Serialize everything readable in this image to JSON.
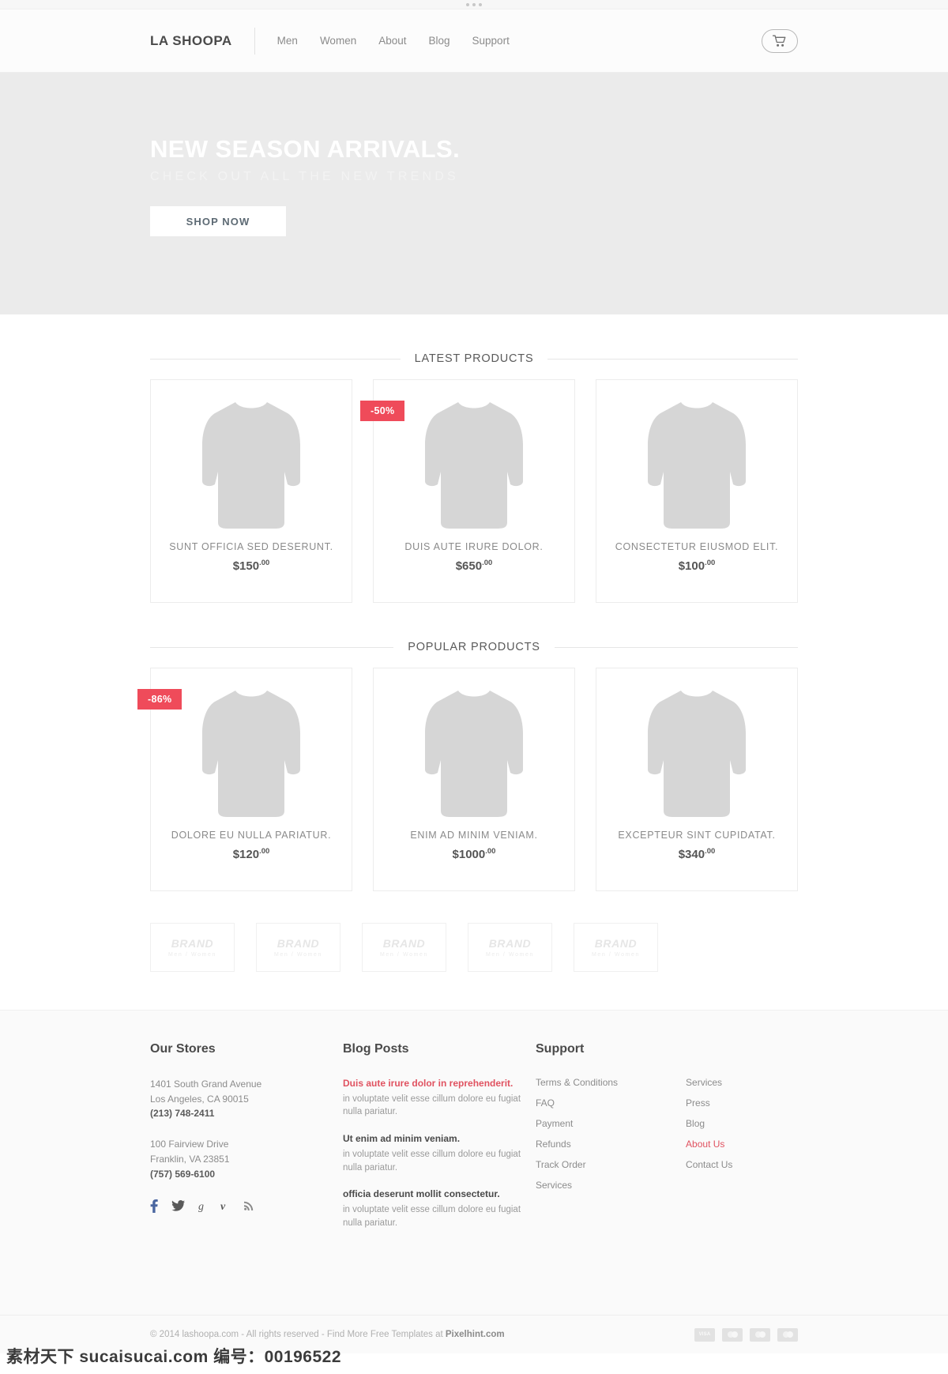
{
  "header": {
    "logo": "LA SHOOPA",
    "nav": [
      {
        "label": "Men"
      },
      {
        "label": "Women"
      },
      {
        "label": "About"
      },
      {
        "label": "Blog"
      },
      {
        "label": "Support"
      }
    ],
    "cart_icon": "shopping-cart-icon"
  },
  "hero": {
    "title": "NEW SEASON ARRIVALS.",
    "subtitle": "CHECK OUT ALL THE NEW TRENDS",
    "cta": "SHOP NOW",
    "background_color": "#ebebeb"
  },
  "sections": [
    {
      "heading": "LATEST PRODUCTS",
      "products": [
        {
          "title": "SUNT OFFICIA SED DESERUNT.",
          "price": "$150",
          "cents": ".00",
          "badge": null
        },
        {
          "title": "DUIS AUTE IRURE DOLOR.",
          "price": "$650",
          "cents": ".00",
          "badge": "-50%"
        },
        {
          "title": "CONSECTETUR EIUSMOD ELIT.",
          "price": "$100",
          "cents": ".00",
          "badge": null
        }
      ]
    },
    {
      "heading": "POPULAR PRODUCTS",
      "products": [
        {
          "title": "DOLORE EU NULLA PARIATUR.",
          "price": "$120",
          "cents": ".00",
          "badge": "-86%"
        },
        {
          "title": "ENIM AD MINIM VENIAM.",
          "price": "$1000",
          "cents": ".00",
          "badge": null
        },
        {
          "title": "EXCEPTEUR SINT CUPIDATAT.",
          "price": "$340",
          "cents": ".00",
          "badge": null
        }
      ]
    }
  ],
  "brands": [
    {
      "name": "BRAND",
      "tagline": "Men / Women"
    },
    {
      "name": "BRAND",
      "tagline": "Men / Women"
    },
    {
      "name": "BRAND",
      "tagline": "Men / Women"
    },
    {
      "name": "BRAND",
      "tagline": "Men / Women"
    },
    {
      "name": "BRAND",
      "tagline": "Men / Women"
    }
  ],
  "footer": {
    "stores": {
      "heading": "Our Stores",
      "locations": [
        {
          "address": "1401 South Grand Avenue",
          "city": "Los Angeles, CA 90015",
          "phone": "(213) 748-2411"
        },
        {
          "address": "100 Fairview Drive",
          "city": "Franklin, VA 23851",
          "phone": "(757) 569-6100"
        }
      ],
      "social": [
        {
          "name": "facebook-icon",
          "glyph": "f"
        },
        {
          "name": "twitter-icon",
          "glyph": "t"
        },
        {
          "name": "google-icon",
          "glyph": "g"
        },
        {
          "name": "vimeo-icon",
          "glyph": "v"
        },
        {
          "name": "rss-icon",
          "glyph": "r"
        }
      ]
    },
    "blog": {
      "heading": "Blog Posts",
      "posts": [
        {
          "title": "Duis aute irure dolor in reprehenderit.",
          "excerpt": " in voluptate velit esse cillum dolore eu fugiat nulla pariatur.",
          "active": true
        },
        {
          "title": "Ut enim ad minim veniam.",
          "excerpt": " in voluptate velit esse cillum dolore eu fugiat nulla pariatur.",
          "active": false
        },
        {
          "title": "officia deserunt mollit consectetur.",
          "excerpt": " in voluptate velit esse cillum dolore eu fugiat nulla pariatur.",
          "active": false
        }
      ]
    },
    "support": {
      "heading": "Support",
      "column_one": [
        {
          "label": "Terms & Conditions",
          "active": false
        },
        {
          "label": "FAQ",
          "active": false
        },
        {
          "label": "Payment",
          "active": false
        },
        {
          "label": "Refunds",
          "active": false
        },
        {
          "label": "Track Order",
          "active": false
        },
        {
          "label": "Services",
          "active": false
        }
      ],
      "column_two": [
        {
          "label": "Services",
          "active": false
        },
        {
          "label": "Press",
          "active": false
        },
        {
          "label": "Blog",
          "active": false
        },
        {
          "label": "About Us",
          "active": true
        },
        {
          "label": "Contact Us",
          "active": false
        }
      ]
    },
    "bottom": {
      "copyright_pre": "© 2014 lashoopa.com - All rights reserved - Find More Free Templates at ",
      "copyright_brand": "Pixelhint.com",
      "payment_icons": [
        {
          "name": "visa-icon",
          "label": "VISA"
        },
        {
          "name": "mastercard-icon",
          "label": ""
        },
        {
          "name": "amex-icon",
          "label": ""
        },
        {
          "name": "discover-icon",
          "label": ""
        }
      ]
    }
  },
  "watermark": "素材天下 sucaisucai.com 编号：00196522",
  "colors": {
    "accent_red": "#e05260",
    "badge_red": "#ef4b5a",
    "hero_bg": "#ebebeb",
    "footer_bg": "#fafafa"
  }
}
